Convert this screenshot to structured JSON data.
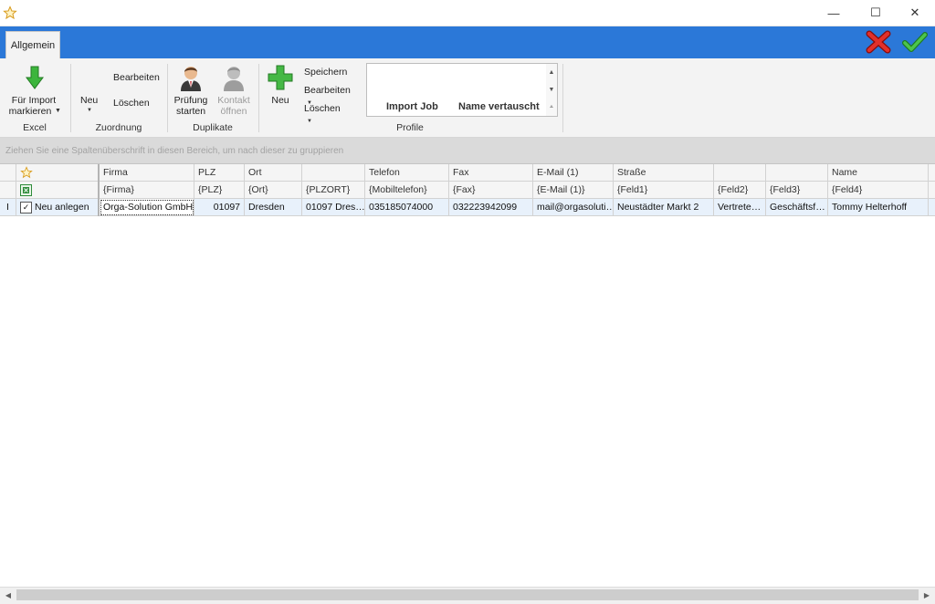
{
  "window": {
    "icon": "star-icon",
    "minimize_glyph": "—",
    "maximize_glyph": "☐",
    "close_glyph": "✕"
  },
  "ribbon": {
    "tab": "Allgemein",
    "groups": {
      "excel": {
        "label": "Excel",
        "import_button_line1": "Für Import",
        "import_button_line2": "markieren"
      },
      "zuordnung": {
        "label": "Zuordnung",
        "neu": "Neu",
        "bearbeiten": "Bearbeiten",
        "loeschen": "Löschen"
      },
      "duplikate": {
        "label": "Duplikate",
        "pruefung_line1": "Prüfung",
        "pruefung_line2": "starten",
        "kontakt_line1": "Kontakt",
        "kontakt_line2": "öffnen"
      },
      "profile": {
        "label": "Profile",
        "neu": "Neu",
        "speichern": "Speichern",
        "bearbeiten": "Bearbeiten",
        "loeschen": "Löschen",
        "items": [
          "Import Job",
          "Name vertauscht"
        ]
      }
    },
    "cancel_icon": "red-x-icon",
    "confirm_icon": "green-check-icon"
  },
  "grid": {
    "group_panel_hint": "Ziehen Sie eine Spaltenüberschrift in diesen Bereich, um nach dieser zu gruppieren",
    "columns": [
      "Firma",
      "PLZ",
      "Ort",
      "",
      "Telefon",
      "Fax",
      "E-Mail (1)",
      "Straße",
      "",
      "",
      "Name"
    ],
    "mappings": [
      "{Firma}",
      "{PLZ}",
      "{Ort}",
      "{PLZORT}",
      "{Mobiltelefon}",
      "{Fax}",
      "{E-Mail (1)}",
      "{Feld1}",
      "{Feld2}",
      "{Feld3}",
      "{Feld4}"
    ],
    "row": {
      "indicator": "I",
      "action": "Neu anlegen",
      "checked": true,
      "cells": [
        "Orga-Solution GmbH",
        "01097",
        "Dresden",
        "01097 Dres…",
        "035185074000",
        "032223942099",
        "mail@orgasoluti…",
        "Neustädter Markt 2",
        "Vertrete…",
        "Geschäftsf…",
        "Tommy Helterhoff"
      ]
    }
  },
  "colors": {
    "tab_bar": "#2b78d8",
    "ribbon_bg": "#f3f3f3",
    "row_highlight": "#e8f1fb"
  }
}
